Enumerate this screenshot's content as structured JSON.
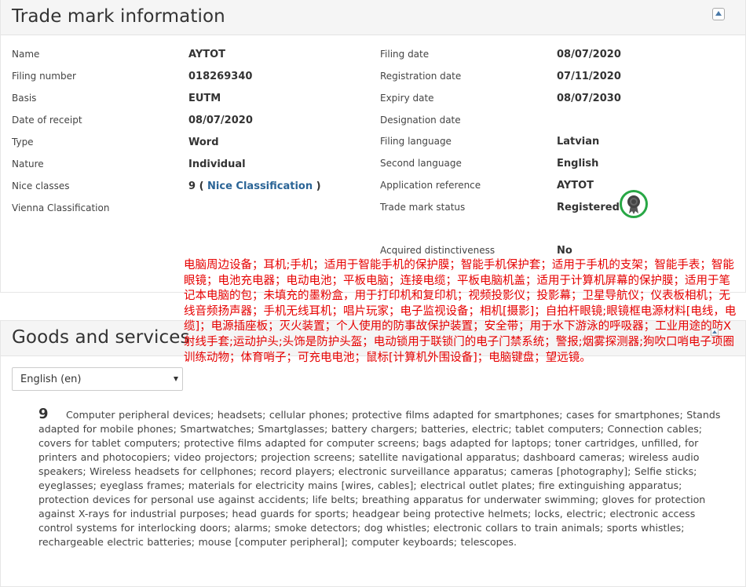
{
  "trademark": {
    "title": "Trade mark information",
    "left_fields": [
      {
        "label": "Name",
        "value": "AYTOT"
      },
      {
        "label": "Filing number",
        "value": "018269340"
      },
      {
        "label": "Basis",
        "value": "EUTM"
      },
      {
        "label": "Date of receipt",
        "value": "08/07/2020"
      },
      {
        "label": "Type",
        "value": "Word"
      },
      {
        "label": "Nature",
        "value": "Individual"
      },
      {
        "label": "Nice classes",
        "value": "9 (",
        "link": "Nice Classification",
        "suffix": ")"
      },
      {
        "label": "Vienna Classification",
        "value": ""
      }
    ],
    "right_fields": [
      {
        "label": "Filing date",
        "value": "08/07/2020"
      },
      {
        "label": "Registration date",
        "value": "07/11/2020"
      },
      {
        "label": "Expiry date",
        "value": "08/07/2030"
      },
      {
        "label": "Designation date",
        "value": ""
      },
      {
        "label": "Filing language",
        "value": "Latvian"
      },
      {
        "label": "Second language",
        "value": "English"
      },
      {
        "label": "Application reference",
        "value": "AYTOT"
      },
      {
        "label": "Trade mark status",
        "value": "Registered"
      },
      {
        "label": "Acquired distinctiveness",
        "value": "No"
      }
    ],
    "status_icon": "award-ribbon-icon",
    "status_color": "#28a745"
  },
  "translation_overlay": {
    "text": "电脑周边设备；耳机;手机；适用于智能手机的保护膜；智能手机保护套；适用于手机的支架；智能手表；智能眼镜；电池充电器；电动电池；平板电脑；连接电缆；平板电脑机盖；适用于计算机屏幕的保护膜；适用于笔记本电脑的包；未填充的墨粉盒，用于打印机和复印机；视频投影仪；投影幕；卫星导航仪；仪表板相机；无线音频扬声器；手机无线耳机；唱片玩家；电子监视设备；相机[摄影]；自拍杆眼镜;眼镜框电源材料[电线，电缆]；电源插座板；灭火装置；个人使用的防事故保护装置；安全带；用于水下游泳的呼吸器；工业用途的防X射线手套;运动护头;头饰是防护头盔；电动锁用于联锁门的电子门禁系统；警报;烟雾探测器;狗吹口哨电子项圈训练动物；体育哨子；可充电电池；鼠标[计算机外围设备]；电脑键盘；望远镜。",
    "color": "#e60000"
  },
  "goods": {
    "title": "Goods and services",
    "language_select": "English (en)",
    "class_number": "9",
    "description": "Computer peripheral devices; headsets; cellular phones; protective films adapted for smartphones; cases for smartphones; Stands adapted for mobile phones; Smartwatches; Smartglasses; battery chargers; batteries, electric; tablet computers; Connection cables; covers for tablet computers; protective films adapted for computer screens; bags adapted for laptops; toner cartridges, unfilled, for printers and photocopiers; video projectors; projection screens; satellite navigational apparatus; dashboard cameras; wireless audio speakers; Wireless headsets for cellphones; record players; electronic surveillance apparatus; cameras [photography]; Selfie sticks; eyeglasses; eyeglass frames; materials for electricity mains [wires, cables]; electrical outlet plates; fire extinguishing apparatus; protection devices for personal use against accidents; life belts; breathing apparatus for underwater swimming; gloves for protection against X-rays for industrial purposes; head guards for sports; headgear being protective helmets; locks, electric; electronic access control systems for interlocking doors; alarms; smoke detectors; dog whistles; electronic collars to train animals; sports whistles; rechargeable electric batteries; mouse [computer peripheral]; computer keyboards; telescopes."
  }
}
